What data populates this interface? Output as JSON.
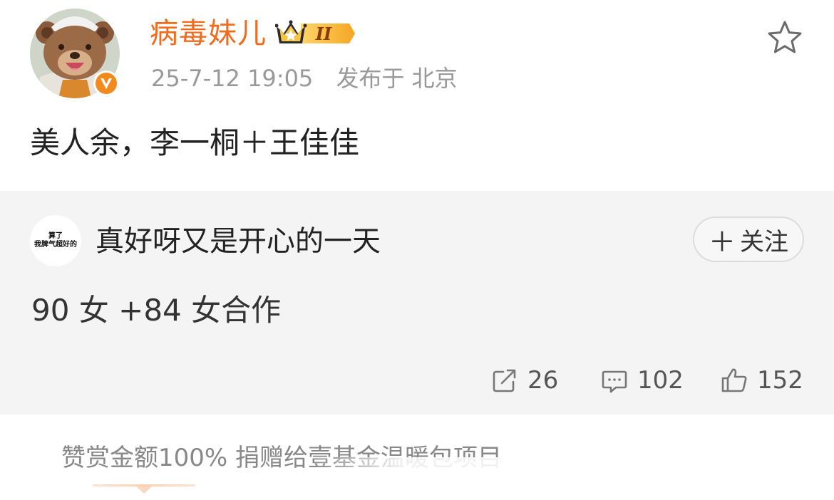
{
  "post": {
    "author_name": "病毒妹儿",
    "vip_level": "II",
    "timestamp": "25-7-12 19:05",
    "source": "发布于 北京",
    "content": "美人余，李一桐＋王佳佳",
    "icons": {
      "avatar": "bear-avatar-icon",
      "verified": "verified-v-badge-icon",
      "vip": "crown-vip-icon",
      "favorite": "star-outline-icon"
    },
    "colors": {
      "author_name": "#f26b1d",
      "verified_badge": "#f28a1e"
    }
  },
  "repost": {
    "author_avatar_text": [
      "算了",
      "我脾气超好的"
    ],
    "author_name": "真好呀又是开心的一天",
    "follow_label": "关注",
    "follow_icon": "plus-icon",
    "content": "90 女 +84 女合作",
    "actions": {
      "share": {
        "icon": "share-icon",
        "count": "26"
      },
      "comment": {
        "icon": "comment-icon",
        "count": "102"
      },
      "like": {
        "icon": "thumbs-up-icon",
        "count": "152"
      }
    }
  },
  "footer": {
    "donate_text": "赞赏金额100% 捐赠给壹基金温暖包项目"
  }
}
